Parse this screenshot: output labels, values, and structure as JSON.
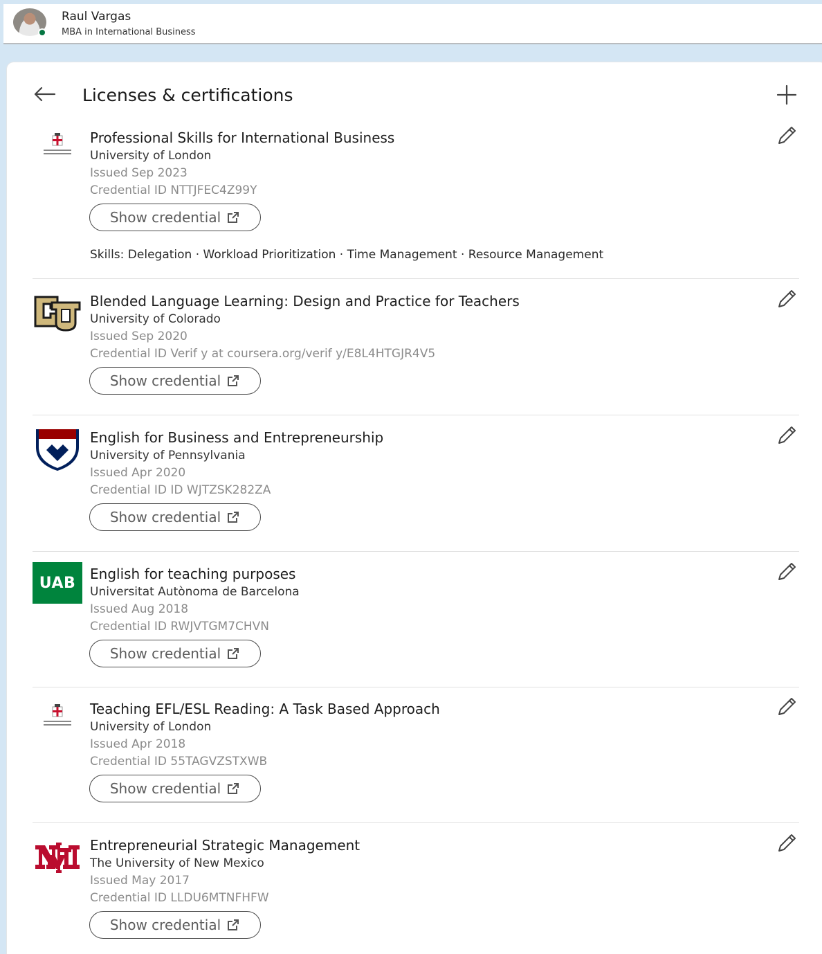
{
  "profile": {
    "name": "Raul Vargas",
    "headline": "MBA in International Business"
  },
  "section": {
    "title": "Licenses & certifications"
  },
  "credential_button_label": "Show credential",
  "entries": [
    {
      "title": "Professional Skills for International Business",
      "issuer": "University of London",
      "issued": "Issued Sep 2023",
      "credential": "Credential ID NTTJFEC4Z99Y",
      "skills": "Skills: Delegation · Workload Prioritization · Time Management · Resource Management",
      "logo_icon": "university-of-london-logo"
    },
    {
      "title": "Blended Language Learning: Design and Practice for Teachers",
      "issuer": "University of Colorado",
      "issued": "Issued Sep 2020",
      "credential": "Credential ID Verif y at coursera.org/verif y/E8L4HTGJR4V5",
      "logo_icon": "university-of-colorado-logo"
    },
    {
      "title": "English for Business and Entrepreneurship",
      "issuer": "University of Pennsylvania",
      "issued": "Issued Apr 2020",
      "credential": "Credential ID ID WJTZSK282ZA",
      "logo_icon": "university-of-pennsylvania-logo"
    },
    {
      "title": "English for teaching purposes",
      "issuer": "Universitat Autònoma de Barcelona",
      "issued": "Issued Aug 2018",
      "credential": "Credential ID RWJVTGM7CHVN",
      "logo_icon": "uab-logo",
      "logo_text": "UAB"
    },
    {
      "title": "Teaching EFL/ESL Reading: A Task Based Approach",
      "issuer": "University of London",
      "issued": "Issued Apr 2018",
      "credential": "Credential ID 55TAGVZSTXWB",
      "logo_icon": "university-of-london-logo"
    },
    {
      "title": "Entrepreneurial Strategic Management",
      "issuer": "The University of New Mexico",
      "issued": "Issued May 2017",
      "credential": "Credential ID LLDU6MTNFHFW",
      "logo_icon": "university-of-new-mexico-logo"
    }
  ],
  "colors": {
    "page_background": "#d4e6f4",
    "presence_green": "#057642",
    "uab_green": "#00843d",
    "colorado_gold": "#cfb87c",
    "penn_blue": "#011f5b",
    "penn_red": "#990000",
    "unm_red": "#ba0c2f",
    "london_red": "#c8102e"
  }
}
